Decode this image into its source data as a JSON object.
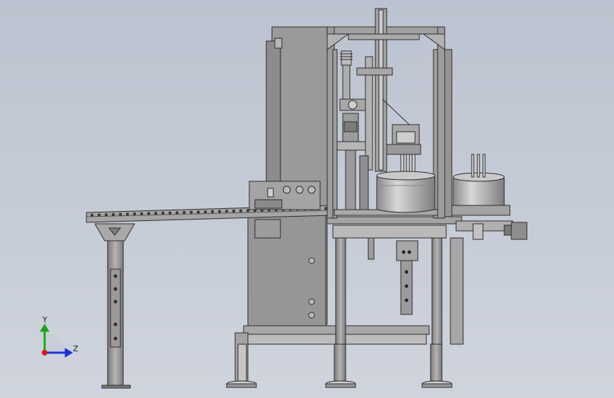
{
  "triad": {
    "y_label": "Y",
    "z_label": "Z",
    "colors": {
      "y_axis": "#18a818",
      "z_axis": "#1c2fd6",
      "x_origin": "#d81818"
    }
  },
  "model": {
    "colors": {
      "steel": "#8f8f8f",
      "steel_light": "#a9a9a9",
      "steel_dark": "#6b6b6b",
      "outline": "#2b2b2b"
    }
  }
}
